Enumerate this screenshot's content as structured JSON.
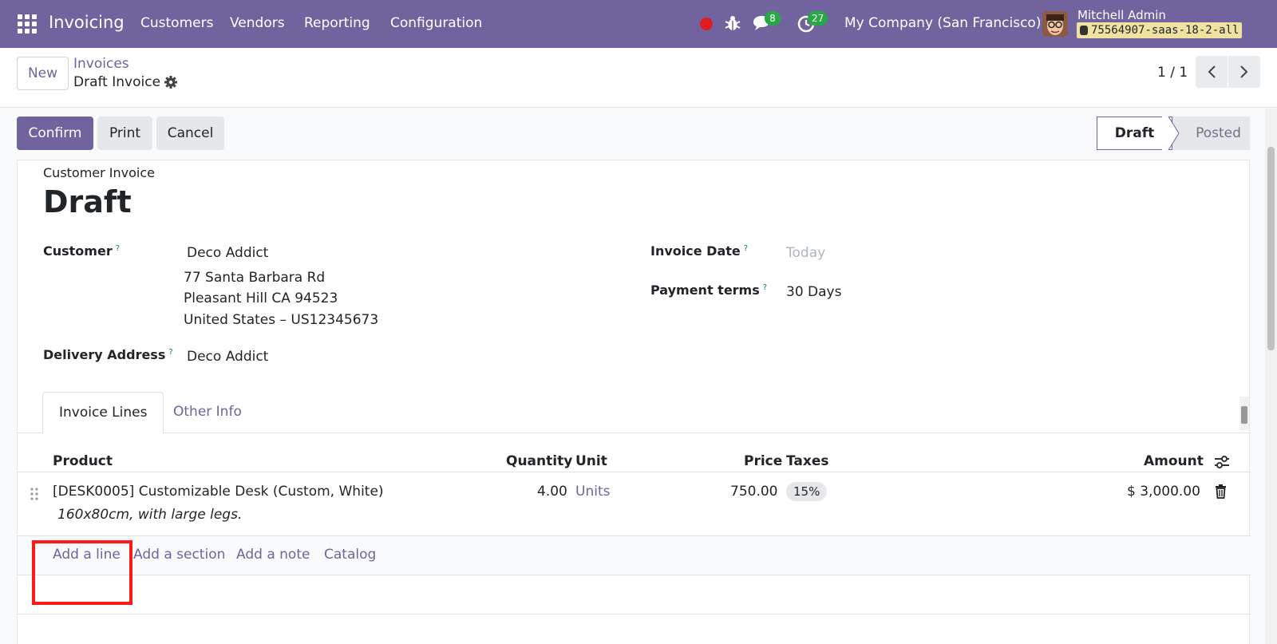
{
  "navbar": {
    "app_name": "Invoicing",
    "menu": [
      "Customers",
      "Vendors",
      "Reporting",
      "Configuration"
    ],
    "messages_count": "8",
    "activities_count": "27",
    "company": "My Company (San Francisco)",
    "user_name": "Mitchell Admin",
    "database": "75564907-saas-18-2-all"
  },
  "control": {
    "new_label": "New",
    "breadcrumb_parent": "Invoices",
    "breadcrumb_current": "Draft Invoice",
    "pager": "1 / 1"
  },
  "actions": {
    "confirm": "Confirm",
    "print": "Print",
    "cancel": "Cancel"
  },
  "statusbar": {
    "stages": [
      "Draft",
      "Posted"
    ],
    "active": "Draft"
  },
  "invoice": {
    "type": "Customer Invoice",
    "title": "Draft",
    "customer_label": "Customer",
    "customer": "Deco Addict",
    "address": [
      "77 Santa Barbara Rd",
      "Pleasant Hill CA 94523",
      "United States – US12345673"
    ],
    "delivery_label": "Delivery Address",
    "delivery": "Deco Addict",
    "invoice_date_label": "Invoice Date",
    "invoice_date_placeholder": "Today",
    "payment_terms_label": "Payment terms",
    "payment_terms": "30 Days",
    "help_mark": "?"
  },
  "tabs": [
    "Invoice Lines",
    "Other Info"
  ],
  "lines": {
    "headers": {
      "product": "Product",
      "quantity": "Quantity",
      "unit": "Unit",
      "price": "Price",
      "taxes": "Taxes",
      "amount": "Amount"
    },
    "rows": [
      {
        "product": "[DESK0005] Customizable Desk (Custom, White)",
        "description": "160x80cm, with large legs.",
        "quantity": "4.00",
        "unit": "Units",
        "price": "750.00",
        "tax": "15%",
        "amount": "$ 3,000.00"
      }
    ],
    "add_links": [
      "Add a line",
      "Add a section",
      "Add a note",
      "Catalog"
    ]
  },
  "colors": {
    "brand": "#71639e",
    "highlight": "#ff1a1a",
    "badge": "#28a745"
  }
}
